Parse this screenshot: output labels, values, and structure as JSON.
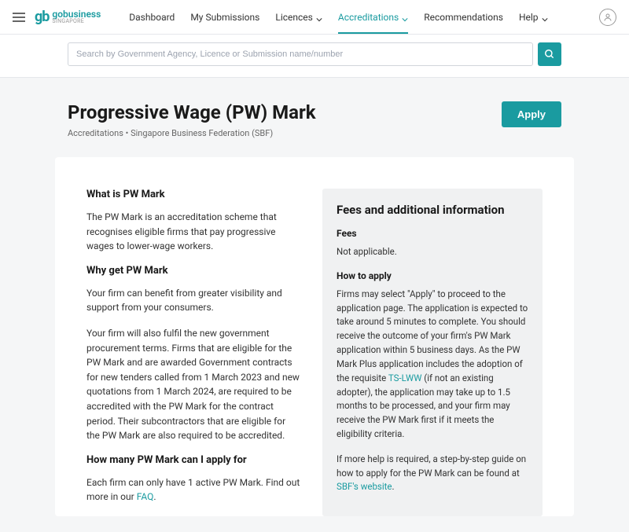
{
  "brand": {
    "mark": "gb",
    "primary": "gobusiness",
    "secondary": "SINGAPORE"
  },
  "nav": {
    "items": [
      {
        "label": "Dashboard",
        "dropdown": false
      },
      {
        "label": "My Submissions",
        "dropdown": false
      },
      {
        "label": "Licences",
        "dropdown": true
      },
      {
        "label": "Accreditations",
        "dropdown": true,
        "active": true
      },
      {
        "label": "Recommendations",
        "dropdown": false
      },
      {
        "label": "Help",
        "dropdown": true
      }
    ]
  },
  "search": {
    "placeholder": "Search by Government Agency, Licence or Submission name/number"
  },
  "header": {
    "title": "Progressive Wage (PW) Mark",
    "crumb_root": "Accreditations",
    "crumb_sep": " • ",
    "crumb_leaf": "Singapore Business Federation (SBF)",
    "apply_label": "Apply"
  },
  "left": {
    "h1": "What is PW Mark",
    "p1": "The PW Mark is an accreditation scheme that recognises eligible firms that pay progressive wages to lower-wage workers.",
    "h2": "Why get PW Mark",
    "p2": "Your firm can benefit from greater visibility and support from your consumers.",
    "p3": "Your firm will also fulfil the new government procurement terms. Firms that are eligible for the PW Mark and are awarded Government contracts for new tenders called from 1 March 2023 and new quotations from 1 March 2024, are required to be accredited with the PW Mark for the contract period. Their subcontractors that are eligible for the PW Mark are also required to be accredited.",
    "h3": "How many PW Mark can I apply for",
    "p4a": "Each firm can only have 1 active PW Mark. Find out more in our ",
    "faq_link": "FAQ",
    "p4b": "."
  },
  "right": {
    "title": "Fees and additional information",
    "fees_h": "Fees",
    "fees_p": "Not applicable.",
    "how_h": "How to apply",
    "how_p1a": "Firms may select \"Apply\" to proceed to the application page. The application is expected to take around 5 minutes to complete. You should receive the outcome of your firm's PW Mark application within 5 business days. As the PW Mark Plus application includes the adoption of the requisite ",
    "tslww_link": "TS-LWW",
    "how_p1b": " (if not an existing adopter), the application may take up to 1.5 months to be processed, and your firm may receive the PW Mark first if it meets the eligibility criteria.",
    "how_p2a": "If more help is required, a step-by-step guide on how to apply for the PW Mark can be found at ",
    "sbf_link": "SBF's website",
    "how_p2b": "."
  }
}
